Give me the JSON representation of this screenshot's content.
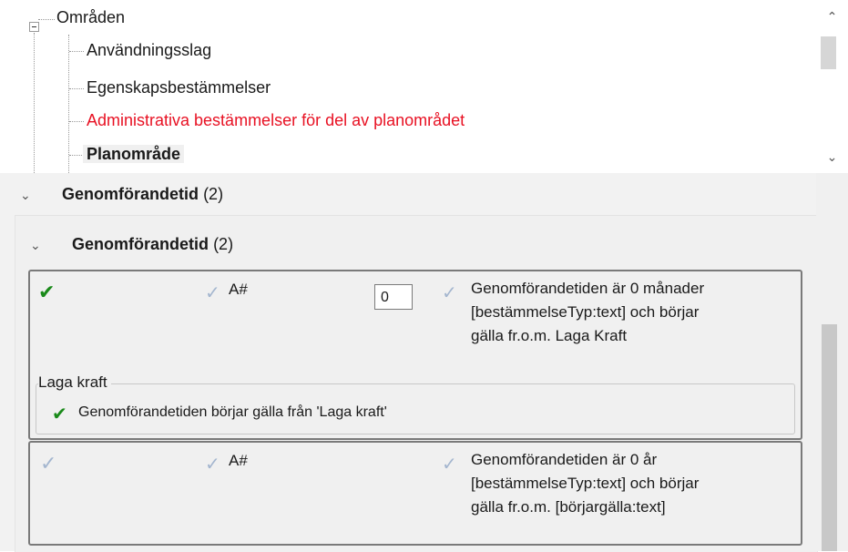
{
  "tree": {
    "root_label": "Områden",
    "items": [
      {
        "label": "Användningsslag",
        "style": "normal"
      },
      {
        "label": "Egenskapsbestämmelser",
        "style": "normal"
      },
      {
        "label": "Administrativa bestämmelser för del av planområdet",
        "style": "red"
      },
      {
        "label": "Planområde",
        "style": "bold-selected"
      }
    ],
    "scroll_up_icon": "chevron-up-icon",
    "scroll_down_icon": "chevron-down-icon"
  },
  "panel": {
    "outer_section": {
      "title": "Genomförandetid",
      "count": "(2)"
    },
    "inner_section": {
      "title": "Genomförandetid",
      "count": "(2)"
    },
    "cards": [
      {
        "status": "valid",
        "code": "A#",
        "number_value": "0",
        "description_lines": [
          "Genomförandetiden är 0 månader",
          "[bestämmelseTyp:text] och börjar",
          "gälla fr.o.m. Laga Kraft"
        ],
        "group": {
          "legend": "Laga kraft",
          "option": "Genomförandetiden börjar gälla från 'Laga kraft'"
        }
      },
      {
        "status": "pending",
        "code": "A#",
        "description_lines": [
          "Genomförandetiden är 0 år",
          "[bestämmelseTyp:text] och börjar",
          "gälla fr.o.m. [börjargälla:text]"
        ]
      }
    ]
  },
  "colors": {
    "check_valid": "#1a8a1a",
    "check_pending": "#a4b6cf",
    "error_red": "#e81123"
  }
}
